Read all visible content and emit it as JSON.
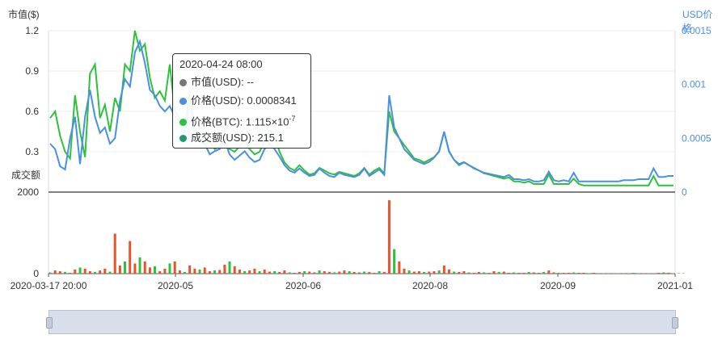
{
  "axes": {
    "left_title": "市值($)",
    "right_title": "USD价格",
    "volume_title": "成交额",
    "left_ticks": [
      "1.2",
      "0.9",
      "0.6",
      "0.3"
    ],
    "right_ticks": [
      "0.0015",
      "0.001",
      "0.0005",
      "0"
    ],
    "volume_ticks": [
      "2000",
      "0"
    ],
    "x_ticks": [
      "2020-03-17 20:00",
      "2020-05",
      "2020-06",
      "2020-08",
      "2020-09",
      "2021-01"
    ]
  },
  "tooltip": {
    "time": "2020-04-24 08:00",
    "rows": [
      {
        "label": "市值(USD): --",
        "color": "#777777"
      },
      {
        "label": "价格(USD): 0.0008341",
        "color": "#4a90e2"
      },
      {
        "label": "价格(BTC): 1.115×10",
        "sup": "-7",
        "color": "#2ec13c"
      },
      {
        "label": "成交额(USD): 215.1",
        "color": "#1f9b6e"
      }
    ]
  },
  "colors": {
    "usd_price": "#4a90e2",
    "btc_price": "#2ec13c",
    "volume_up": "#e8542a",
    "volume_down": "#2ec13c"
  },
  "chart_data": {
    "type": "line",
    "x_range": [
      "2020-03-17 20:00",
      "2021-01"
    ],
    "y_left_range": [
      0,
      1.2
    ],
    "y_right_range": [
      0,
      0.0015
    ],
    "volume_range": [
      0,
      2000
    ],
    "series": [
      {
        "name": "价格(USD)",
        "axis": "right",
        "values": [
          0.00045,
          0.0004,
          0.00024,
          0.00021,
          0.0005,
          0.0007,
          0.00026,
          0.0007,
          0.00095,
          0.0007,
          0.00055,
          0.0006,
          0.00045,
          0.0005,
          0.00085,
          0.00105,
          0.00098,
          0.0013,
          0.0014,
          0.0012,
          0.00095,
          0.0009,
          0.0008,
          0.00075,
          0.0008,
          0.0007,
          0.00065,
          0.00055,
          0.00083,
          0.00055,
          0.0005,
          0.00045,
          0.00035,
          0.00038,
          0.0004,
          0.00048,
          0.00035,
          0.0003,
          0.00034,
          0.00038,
          0.00032,
          0.00028,
          0.0003,
          0.0004,
          0.00045,
          0.0004,
          0.00033,
          0.00025,
          0.0002,
          0.00018,
          0.00022,
          0.00018,
          0.00015,
          0.00016,
          0.00022,
          0.00018,
          0.00015,
          0.00014,
          0.00018,
          0.00016,
          0.00015,
          0.00014,
          0.00016,
          0.00022,
          0.00015,
          0.00018,
          0.00021,
          0.00016,
          0.0009,
          0.0006,
          0.0005,
          0.0004,
          0.00035,
          0.0003,
          0.00028,
          0.00026,
          0.00028,
          0.00032,
          0.00038,
          0.00056,
          0.00038,
          0.0003,
          0.00026,
          0.00028,
          0.00025,
          0.00022,
          0.0002,
          0.00018,
          0.00017,
          0.00016,
          0.00015,
          0.00014,
          0.00016,
          0.00012,
          0.00012,
          0.00011,
          0.00012,
          0.0001,
          0.0001,
          0.00011,
          0.00019,
          0.00011,
          0.0001,
          0.00011,
          0.0001,
          0.00018,
          0.0001,
          0.0001,
          0.0001,
          0.0001,
          0.0001,
          0.0001,
          0.0001,
          0.0001,
          0.0001,
          0.00011,
          0.00011,
          0.00011,
          0.00012,
          0.00012,
          0.00012,
          0.00022,
          0.00014,
          0.00014,
          0.00015,
          0.00015
        ]
      },
      {
        "name": "价格(BTC)",
        "axis": "left",
        "values": [
          0.55,
          0.6,
          0.42,
          0.3,
          0.25,
          0.72,
          0.45,
          0.26,
          0.88,
          0.95,
          0.55,
          0.65,
          0.45,
          0.7,
          0.6,
          0.95,
          0.9,
          1.2,
          1.05,
          1.1,
          0.85,
          0.7,
          0.75,
          0.68,
          0.95,
          0.6,
          0.55,
          0.5,
          0.75,
          0.45,
          0.4,
          0.35,
          0.38,
          0.32,
          0.34,
          0.4,
          0.32,
          0.3,
          0.34,
          0.38,
          0.32,
          0.28,
          0.3,
          0.38,
          0.46,
          0.42,
          0.3,
          0.22,
          0.18,
          0.16,
          0.2,
          0.16,
          0.13,
          0.14,
          0.18,
          0.16,
          0.14,
          0.13,
          0.15,
          0.14,
          0.13,
          0.12,
          0.14,
          0.18,
          0.13,
          0.16,
          0.18,
          0.14,
          0.6,
          0.45,
          0.4,
          0.35,
          0.3,
          0.25,
          0.24,
          0.22,
          0.24,
          0.26,
          0.3,
          0.45,
          0.3,
          0.24,
          0.2,
          0.22,
          0.2,
          0.18,
          0.16,
          0.14,
          0.13,
          0.12,
          0.11,
          0.1,
          0.11,
          0.08,
          0.08,
          0.07,
          0.08,
          0.06,
          0.06,
          0.06,
          0.13,
          0.06,
          0.06,
          0.06,
          0.06,
          0.1,
          0.06,
          0.05,
          0.05,
          0.05,
          0.05,
          0.05,
          0.05,
          0.05,
          0.05,
          0.05,
          0.05,
          0.05,
          0.05,
          0.05,
          0.05,
          0.12,
          0.05,
          0.05,
          0.05,
          0.05
        ]
      },
      {
        "name": "成交额(USD)",
        "axis": "volume",
        "type": "bar",
        "values": [
          30,
          80,
          60,
          40,
          20,
          100,
          150,
          120,
          60,
          40,
          80,
          120,
          50,
          980,
          200,
          300,
          800,
          250,
          400,
          300,
          150,
          180,
          60,
          120,
          250,
          300,
          80,
          40,
          200,
          120,
          100,
          150,
          60,
          80,
          90,
          220,
          300,
          180,
          100,
          60,
          80,
          120,
          60,
          100,
          50,
          60,
          40,
          80,
          30,
          20,
          40,
          60,
          50,
          30,
          80,
          60,
          40,
          30,
          50,
          80,
          60,
          40,
          30,
          50,
          40,
          20,
          60,
          40,
          1800,
          600,
          300,
          120,
          80,
          50,
          60,
          40,
          50,
          60,
          80,
          200,
          100,
          50,
          40,
          60,
          30,
          20,
          40,
          30,
          20,
          60,
          40,
          50,
          20,
          30,
          20,
          20,
          40,
          30,
          20,
          40,
          80,
          30,
          20,
          20,
          20,
          30,
          20,
          20,
          10,
          20,
          10,
          10,
          10,
          10,
          10,
          10,
          10,
          20,
          10,
          10,
          10,
          10,
          20,
          30,
          20,
          10,
          10,
          10
        ]
      }
    ]
  }
}
